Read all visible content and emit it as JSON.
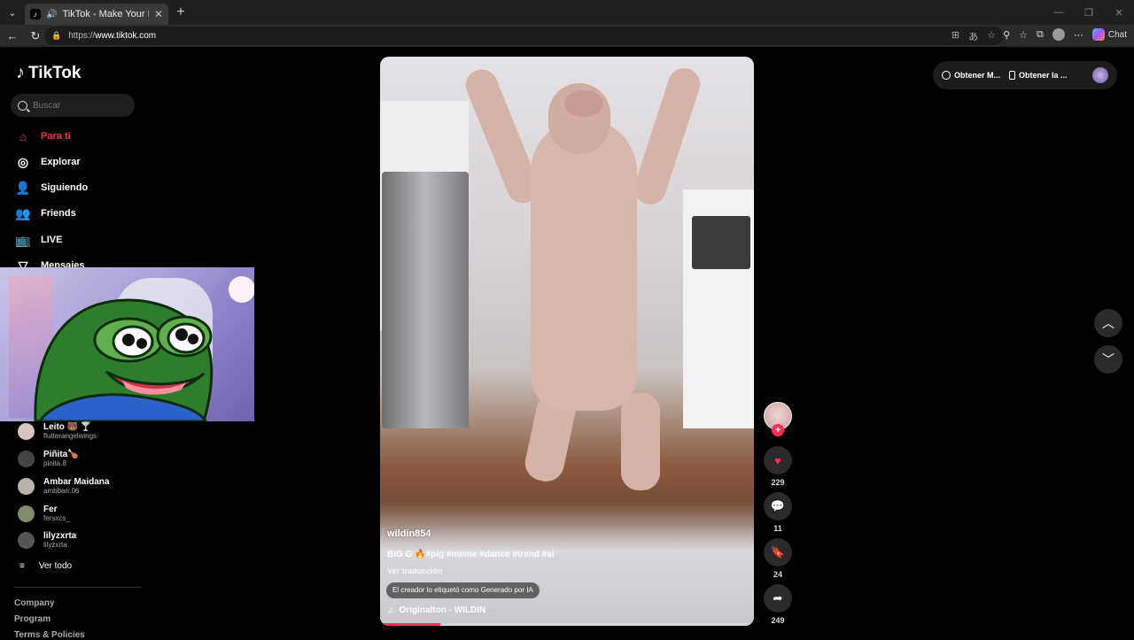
{
  "browser": {
    "tab_title": "TikTok - Make Your Day",
    "tab_close": "✕",
    "new_tab": "+",
    "url_scheme": "https://",
    "url_host": "www.tiktok.com",
    "copilot_label": "Chat"
  },
  "sidebar": {
    "logo": "TikTok",
    "search_placeholder": "Buscar",
    "nav": [
      {
        "label": "Para ti",
        "icon": "home-icon",
        "active": true
      },
      {
        "label": "Explorar",
        "icon": "compass-icon"
      },
      {
        "label": "Siguiendo",
        "icon": "following-icon"
      },
      {
        "label": "Friends",
        "icon": "friends-icon"
      },
      {
        "label": "LIVE",
        "icon": "live-icon"
      },
      {
        "label": "Mensajes",
        "icon": "messages-icon"
      }
    ],
    "following": [
      {
        "name": "Leito 🐻 🍸",
        "handle": "flutterangelwings"
      },
      {
        "name": "Piñita🍗",
        "handle": "pinita.8"
      },
      {
        "name": "Ambar Maidana",
        "handle": "ambbarr.06"
      },
      {
        "name": "Fer",
        "handle": "fersxcs_"
      },
      {
        "name": "lilyzxrta",
        "handle": "lilyzxrta"
      }
    ],
    "see_all": "Ver todo",
    "footer": [
      "Company",
      "Program",
      "Terms & Policies"
    ]
  },
  "video": {
    "username": "wildin854",
    "caption": "BIG G 🔥#pig #meme #dance #trend #ai",
    "translate": "Ver traducción",
    "ai_label": "El creador lo etiquetó como Generado por IA",
    "music": "Originalton - WILDIN",
    "progress": 0.16
  },
  "actions": {
    "follow_plus": "+",
    "likes": "229",
    "comments": "11",
    "saves": "24",
    "shares": "249"
  },
  "topbar": {
    "get_coins": "Obtener M...",
    "get_app": "Obtener la ..."
  },
  "colors": {
    "accent": "#fe2c55",
    "background": "#000000"
  }
}
